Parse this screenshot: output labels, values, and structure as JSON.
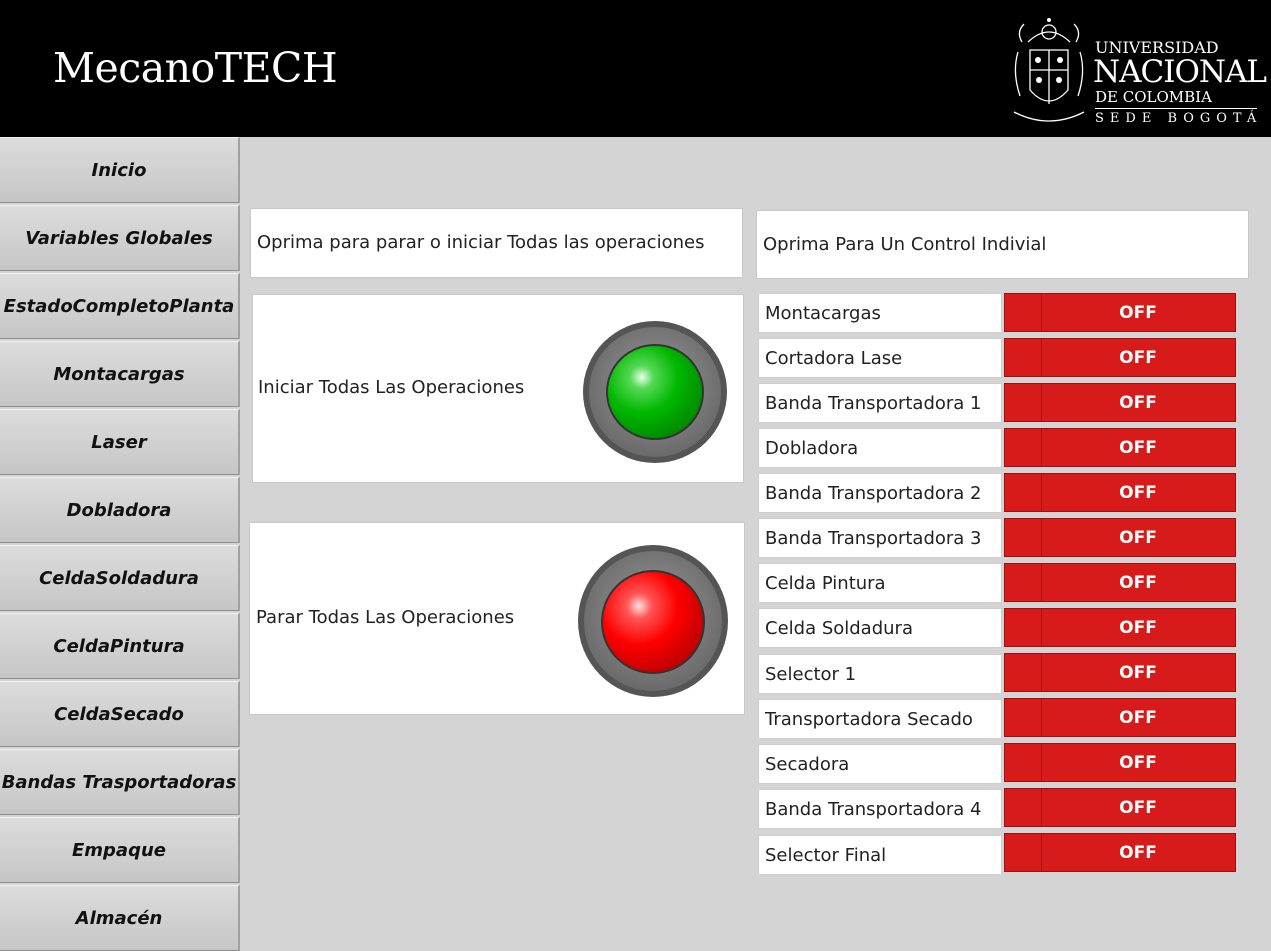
{
  "app": {
    "title": "MecanoTECH"
  },
  "logo": {
    "line1": "UNIVERSIDAD",
    "line2": "NACIONAL",
    "line3": "DE COLOMBIA",
    "line4": "SEDE BOGOTÁ"
  },
  "sidebar": {
    "items": [
      {
        "label": "Inicio"
      },
      {
        "label": "Variables Globales"
      },
      {
        "label": "EstadoCompletoPlanta"
      },
      {
        "label": "Montacargas"
      },
      {
        "label": "Laser"
      },
      {
        "label": "Dobladora"
      },
      {
        "label": "CeldaSoldadura"
      },
      {
        "label": "CeldaPintura"
      },
      {
        "label": "CeldaSecado"
      },
      {
        "label": "Bandas Trasportadoras"
      },
      {
        "label": "Empaque"
      },
      {
        "label": "Almacén"
      }
    ]
  },
  "main": {
    "all_ops_instruction": "Oprima para parar o iniciar Todas las operaciones",
    "individual_instruction": "Oprima Para Un Control Indivial",
    "start_all": {
      "label": "Iniciar Todas Las Operaciones",
      "color": "#00b800"
    },
    "stop_all": {
      "label": "Parar Todas Las Operaciones",
      "color": "#ff0000"
    },
    "controls": [
      {
        "label": "Montacargas",
        "state": "OFF"
      },
      {
        "label": "Cortadora Lase",
        "state": "OFF"
      },
      {
        "label": "Banda Transportadora 1",
        "state": "OFF"
      },
      {
        "label": "Dobladora",
        "state": "OFF"
      },
      {
        "label": "Banda Transportadora 2",
        "state": "OFF"
      },
      {
        "label": "Banda Transportadora 3",
        "state": "OFF"
      },
      {
        "label": "Celda Pintura",
        "state": "OFF"
      },
      {
        "label": "Celda Soldadura",
        "state": "OFF"
      },
      {
        "label": "Selector 1",
        "state": "OFF"
      },
      {
        "label": "Transportadora Secado",
        "state": "OFF"
      },
      {
        "label": "Secadora",
        "state": "OFF"
      },
      {
        "label": "Banda Transportadora 4",
        "state": "OFF"
      },
      {
        "label": "Selector Final",
        "state": "OFF"
      }
    ]
  },
  "colors": {
    "header": "#000000",
    "toggle_off": "#d71a1a",
    "background": "#d4d4d4"
  }
}
